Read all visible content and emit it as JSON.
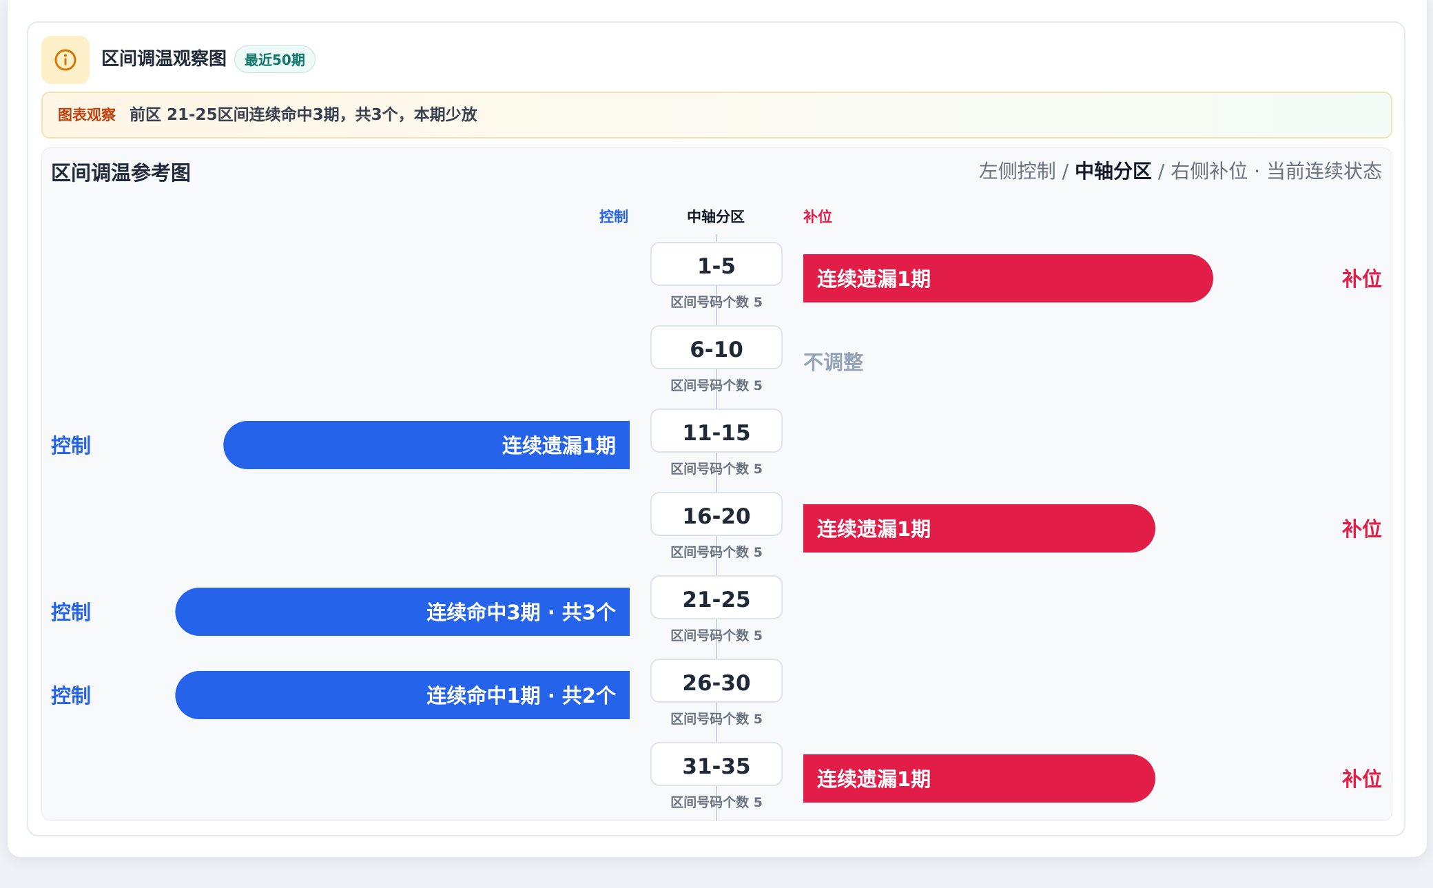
{
  "header": {
    "title": "区间调温观察图",
    "badge": "最近50期",
    "icon": "info-icon"
  },
  "observation": {
    "tag": "图表观察",
    "text": "前区 21-25区间连续命中3期，共3个，本期少放"
  },
  "panel": {
    "title": "区间调温参考图",
    "legend": {
      "left": "左侧控制",
      "sep1": " / ",
      "center": "中轴分区",
      "sep2": " / ",
      "right": "右侧补位",
      "dot": " · ",
      "state": "当前连续状态"
    },
    "col_heads": {
      "left": "控制",
      "center": "中轴分区",
      "right": "补位"
    }
  },
  "colors": {
    "control": "#2563eb",
    "fill": "#e11d48",
    "neutral": "#94a3b8",
    "axis": "#cbd5e1"
  },
  "chart_data": {
    "type": "bar",
    "categories": [
      "1-5",
      "6-10",
      "11-15",
      "16-20",
      "21-25",
      "26-30",
      "31-35"
    ],
    "sublabels": [
      "区间号码个数 5",
      "区间号码个数 5",
      "区间号码个数 5",
      "区间号码个数 5",
      "区间号码个数 5",
      "区间号码个数 5",
      "区间号码个数 5"
    ],
    "rows": [
      {
        "zone": "1-5",
        "side": "right",
        "bar_label": "连续遗漏1期",
        "end_label": "补位",
        "value": 0.85
      },
      {
        "zone": "6-10",
        "side": "none",
        "bar_label": "不调整",
        "end_label": "",
        "value": 0
      },
      {
        "zone": "11-15",
        "side": "left",
        "bar_label": "连续遗漏1期",
        "end_label": "控制",
        "value": 0.76
      },
      {
        "zone": "16-20",
        "side": "right",
        "bar_label": "连续遗漏1期",
        "end_label": "补位",
        "value": 0.73
      },
      {
        "zone": "21-25",
        "side": "left",
        "bar_label": "连续命中3期 · 共3个",
        "end_label": "控制",
        "value": 0.85
      },
      {
        "zone": "26-30",
        "side": "left",
        "bar_label": "连续命中1期 · 共2个",
        "end_label": "控制",
        "value": 0.85
      },
      {
        "zone": "31-35",
        "side": "right",
        "bar_label": "连续遗漏1期",
        "end_label": "补位",
        "value": 0.73
      }
    ]
  }
}
